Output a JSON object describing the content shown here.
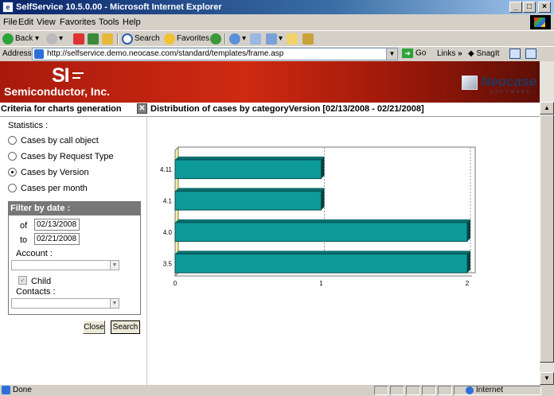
{
  "window": {
    "title": "SelfService 10.5.0.00 - Microsoft Internet Explorer",
    "controls": [
      "_",
      "□",
      "×"
    ]
  },
  "menu": {
    "items": [
      "File",
      "Edit",
      "View",
      "Favorites",
      "Tools",
      "Help"
    ]
  },
  "toolbar": {
    "back": "Back",
    "search": "Search",
    "favorites": "Favorites"
  },
  "address": {
    "label": "Address",
    "url": "http://selfservice.demo.neocase.com/standard/templates/frame.asp",
    "go": "Go",
    "links": "Links",
    "links_chevron": "»",
    "snagit": "SnagIt"
  },
  "banner": {
    "logo_mark": "SI",
    "company": "Semiconductor, Inc.",
    "vendor": "Neocase",
    "vendor_sub": "SOFTWARE"
  },
  "criteria": {
    "title": "Criteria for charts generation",
    "statistics_label": "Statistics :",
    "options": [
      {
        "label": "Cases by call object",
        "selected": false
      },
      {
        "label": "Cases by Request Type",
        "selected": false
      },
      {
        "label": "Cases by Version",
        "selected": true
      },
      {
        "label": "Cases per month",
        "selected": false
      }
    ],
    "filter": {
      "title": "Filter by date :",
      "of_label": "of",
      "of_value": "02/13/2008",
      "to_label": "to",
      "to_value": "02/21/2008",
      "account_label": "Account :",
      "child_label": "Child",
      "child_checked": true,
      "contacts_label": "Contacts :"
    },
    "close_button": "Close",
    "search_button": "Search"
  },
  "chart_data": {
    "type": "bar",
    "orientation": "horizontal",
    "title": "Distribution of cases by categoryVersion [02/13/2008 - 02/21/2008]",
    "categories": [
      "4.11",
      "4.1",
      "4.0",
      "3.5"
    ],
    "values": [
      1,
      1,
      2,
      2
    ],
    "xlim": [
      0,
      2
    ],
    "xticks": [
      0,
      1,
      2
    ],
    "bar_color": "#0e9a99",
    "grid": true
  },
  "status": {
    "text": "Done",
    "zone": "Internet"
  }
}
